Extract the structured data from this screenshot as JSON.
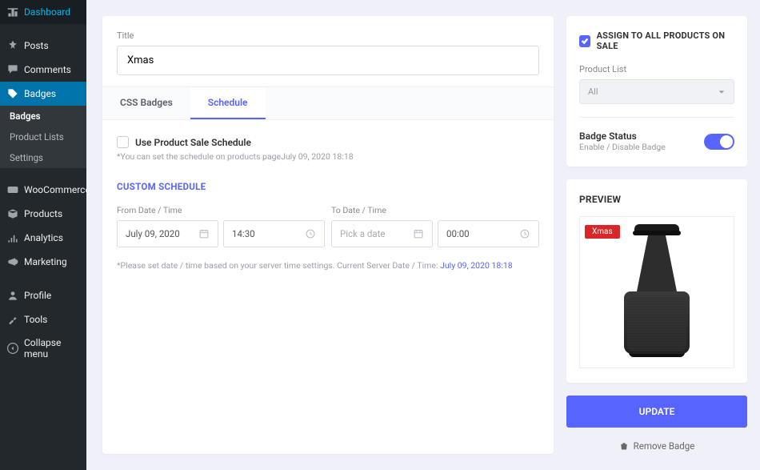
{
  "sidebar": {
    "items": [
      {
        "label": "Dashboard",
        "icon": "dashboard-icon"
      },
      {
        "label": "Posts",
        "icon": "pin-icon"
      },
      {
        "label": "Comments",
        "icon": "comment-icon"
      },
      {
        "label": "Badges",
        "icon": "tag-icon",
        "current": true
      },
      {
        "label": "WooCommerce",
        "icon": "woo-icon"
      },
      {
        "label": "Products",
        "icon": "box-icon"
      },
      {
        "label": "Analytics",
        "icon": "analytics-icon"
      },
      {
        "label": "Marketing",
        "icon": "megaphone-icon"
      },
      {
        "label": "Profile",
        "icon": "profile-icon"
      },
      {
        "label": "Tools",
        "icon": "tools-icon"
      },
      {
        "label": "Collapse menu",
        "icon": "collapse-icon"
      }
    ],
    "submenu": [
      {
        "label": "Badges",
        "active": true
      },
      {
        "label": "Product Lists"
      },
      {
        "label": "Settings"
      }
    ]
  },
  "title": {
    "label": "Title",
    "value": "Xmas"
  },
  "tabs": [
    {
      "label": "CSS Badges",
      "active": false
    },
    {
      "label": "Schedule",
      "active": true
    }
  ],
  "schedule": {
    "use_sale_label": "Use Product Sale Schedule",
    "use_sale_help_prefix": "*You can set the schedule on products page",
    "use_sale_help_time": "July 09, 2020 18:18",
    "custom_heading": "CUSTOM SCHEDULE",
    "from_label": "From Date / Time",
    "to_label": "To Date / Time",
    "from_date": "July 09, 2020",
    "from_time": "14:30",
    "to_date_placeholder": "Pick a date",
    "to_time": "00:00",
    "footnote_text": "*Please set date / time based on your server time settings. Current Server Date / Time:  ",
    "footnote_link": "July 09, 2020 18:18"
  },
  "assign": {
    "checkbox_label": "ASSIGN TO ALL PRODUCTS ON SALE",
    "product_list_label": "Product List",
    "product_list_value": "All",
    "status_title": "Badge Status",
    "status_sub": "Enable / Disable Badge"
  },
  "preview": {
    "heading": "PREVIEW",
    "badge_text": "Xmas"
  },
  "actions": {
    "update": "UPDATE",
    "remove": "Remove Badge"
  }
}
